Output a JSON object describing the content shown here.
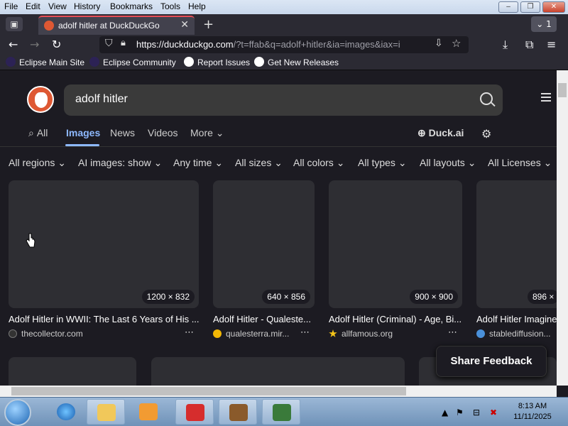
{
  "menu": {
    "items": [
      "File",
      "Edit",
      "View",
      "History",
      "Bookmarks",
      "Tools",
      "Help"
    ]
  },
  "window": {
    "minimize": "–",
    "maximize": "❐",
    "close": "✕"
  },
  "tabstrip": {
    "tab_title": "adolf hitler at DuckDuckGo",
    "tab_close": "✕",
    "new_tab": "+",
    "tab_count": "1",
    "tablist_chevron": "⌄"
  },
  "navbar": {
    "url_host": "https://duckduckgo.com",
    "url_path": "/?t=ffab&q=adolf+hitler&ia=images&iax=i"
  },
  "bookmarks": [
    {
      "label": "Eclipse Main Site",
      "color": "#2c2255"
    },
    {
      "label": "Eclipse Community",
      "color": "#2c2255"
    },
    {
      "label": "Report Issues",
      "color": "#ffffff"
    },
    {
      "label": "Get New Releases",
      "color": "#ffffff"
    }
  ],
  "search": {
    "query": "adolf hitler"
  },
  "search_tabs": [
    "All",
    "Images",
    "News",
    "Videos",
    "More"
  ],
  "duck_ai": "Duck.ai",
  "filters": [
    "All regions",
    "AI images: show",
    "Any time",
    "All sizes",
    "All colors",
    "All types",
    "All layouts",
    "All Licenses"
  ],
  "results": [
    {
      "size": "1200 × 832",
      "title": "Adolf Hitler in WWII: The Last 6 Years of His ...",
      "source": "thecollector.com",
      "icon_color": "#333333"
    },
    {
      "size": "640 × 856",
      "title": "Adolf Hitler - Qualeste...",
      "source": "qualesterra.mir...",
      "icon_color": "#f2b705"
    },
    {
      "size": "900 × 900",
      "title": "Adolf Hitler (Criminal) - Age, Bi...",
      "source": "allfamous.org",
      "icon_color": "#f5c518"
    },
    {
      "size": "896 ×",
      "title": "Adolf Hitler Imagine",
      "source": "stablediffusion...",
      "icon_color": "#4a90d9"
    }
  ],
  "more_dots": "⋯",
  "feedback": "Share Feedback",
  "clock": {
    "time": "8:13 AM",
    "date": "11/11/2025"
  },
  "colors": {
    "accent": "#8eb9ff",
    "tab_indicator": "#e84d56",
    "ddg": "#de5833"
  }
}
